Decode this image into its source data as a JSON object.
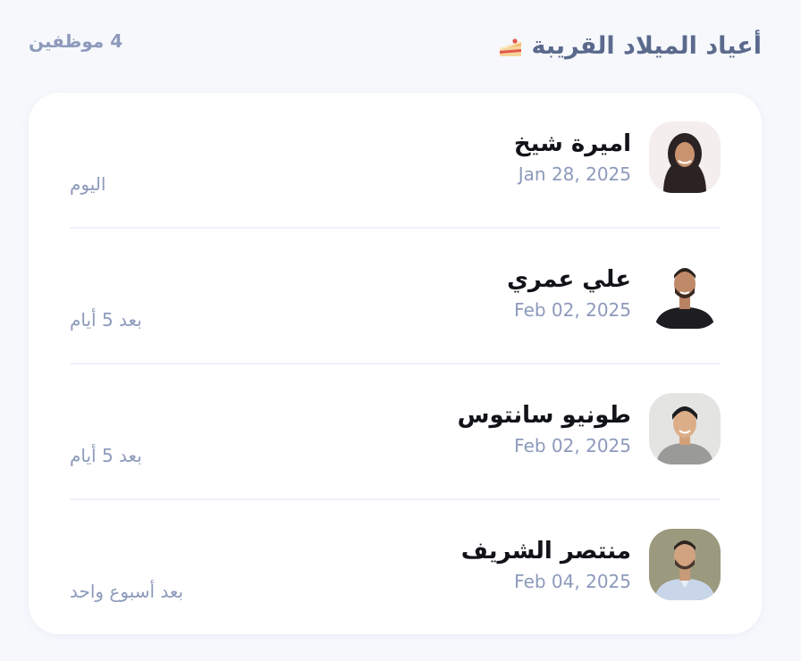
{
  "header": {
    "title": "أعياد الميلاد القريبة",
    "title_icon": "cake-icon",
    "employee_count": "4 موظفين"
  },
  "birthdays": [
    {
      "name": "اميرة شيخ",
      "date": "Jan 28, 2025",
      "when": "اليوم",
      "avatar": "avatar-woman-hijab"
    },
    {
      "name": "علي عمري",
      "date": "Feb 02, 2025",
      "when": "بعد 5 أيام",
      "avatar": "avatar-man-beard"
    },
    {
      "name": "طونيو سانتوس",
      "date": "Feb 02, 2025",
      "when": "بعد 5 أيام",
      "avatar": "avatar-man-smiling"
    },
    {
      "name": "منتصر الشريف",
      "date": "Feb 04, 2025",
      "when": "بعد أسبوع واحد",
      "avatar": "avatar-man-shirt"
    }
  ],
  "colors": {
    "background": "#f6f8fc",
    "card": "#ffffff",
    "title": "#5b6a8c",
    "muted": "#8d9abb",
    "name": "#111318",
    "divider": "#edf1f7"
  }
}
